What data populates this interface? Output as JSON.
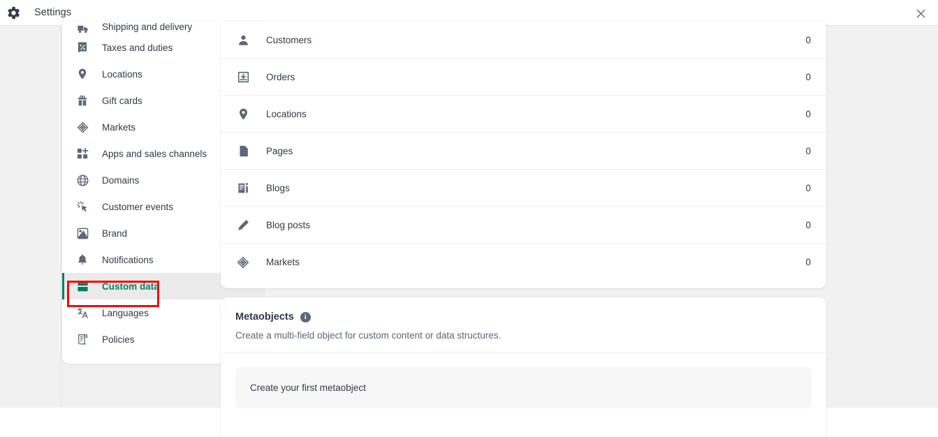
{
  "window": {
    "title": "Settings",
    "gear_icon": "gear-icon",
    "close_icon": "close-icon"
  },
  "sidebar": {
    "items": [
      {
        "label": "Shipping and delivery",
        "icon": "truck-icon",
        "selected": false,
        "clipped": true
      },
      {
        "label": "Taxes and duties",
        "icon": "percent-receipt-icon",
        "selected": false
      },
      {
        "label": "Locations",
        "icon": "location-pin-icon",
        "selected": false
      },
      {
        "label": "Gift cards",
        "icon": "gift-icon",
        "selected": false
      },
      {
        "label": "Markets",
        "icon": "globe-target-icon",
        "selected": false
      },
      {
        "label": "Apps and sales channels",
        "icon": "apps-plus-icon",
        "selected": false
      },
      {
        "label": "Domains",
        "icon": "globe-icon",
        "selected": false
      },
      {
        "label": "Customer events",
        "icon": "cursor-click-icon",
        "selected": false
      },
      {
        "label": "Brand",
        "icon": "image-icon",
        "selected": false
      },
      {
        "label": "Notifications",
        "icon": "bell-icon",
        "selected": false
      },
      {
        "label": "Custom data",
        "icon": "database-icon",
        "selected": true
      },
      {
        "label": "Languages",
        "icon": "translate-icon",
        "selected": false
      },
      {
        "label": "Policies",
        "icon": "scroll-icon",
        "selected": false
      }
    ],
    "selected_color": "#007f5f",
    "selected_background": "#ebebeb"
  },
  "main": {
    "metafield_rows": [
      {
        "label": "Customers",
        "icon": "person-icon",
        "count": "0"
      },
      {
        "label": "Orders",
        "icon": "order-inbox-icon",
        "count": "0"
      },
      {
        "label": "Locations",
        "icon": "location-pin-icon",
        "count": "0"
      },
      {
        "label": "Pages",
        "icon": "page-icon",
        "count": "0"
      },
      {
        "label": "Blogs",
        "icon": "blog-icon",
        "count": "0"
      },
      {
        "label": "Blog posts",
        "icon": "pencil-icon",
        "count": "0"
      },
      {
        "label": "Markets",
        "icon": "globe-target-icon",
        "count": "0"
      }
    ],
    "metaobjects": {
      "title": "Metaobjects",
      "info_icon": "info-icon",
      "info_glyph": "i",
      "description": "Create a multi-field object for custom content or data structures.",
      "empty_state": "Create your first metaobject"
    }
  },
  "annotation": {
    "color": "#ff0000",
    "target": "sidebar-item-custom-data"
  }
}
